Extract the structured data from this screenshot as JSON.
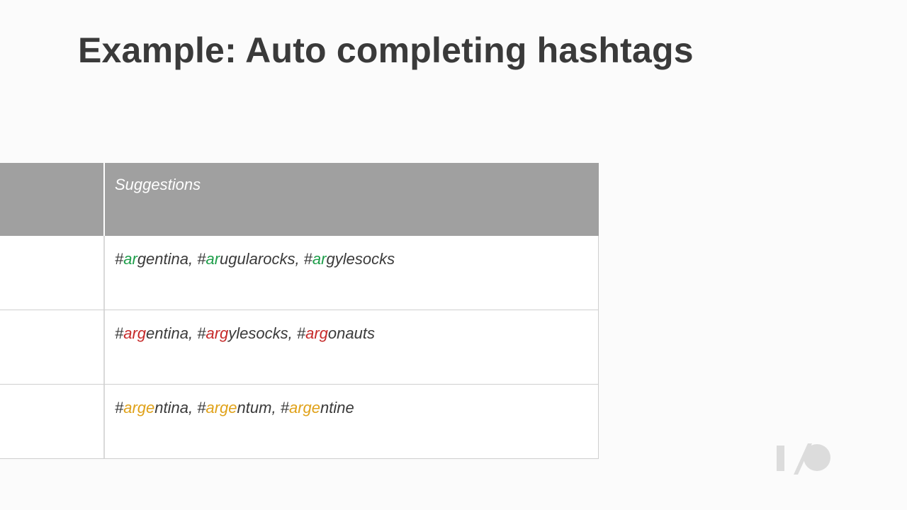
{
  "slide": {
    "title": "Example: Auto completing hashtags"
  },
  "table": {
    "header": {
      "left": "",
      "right": "Suggestions"
    },
    "rows": [
      {
        "color": "#1e9e4a",
        "tags": [
          {
            "hash": "#",
            "prefix": "ar",
            "rest": "gentina"
          },
          {
            "hash": "#",
            "prefix": "ar",
            "rest": "ugularocks"
          },
          {
            "hash": "#",
            "prefix": "ar",
            "rest": "gylesocks"
          }
        ]
      },
      {
        "color": "#c62a2a",
        "tags": [
          {
            "hash": "#",
            "prefix": "arg",
            "rest": "entina"
          },
          {
            "hash": "#",
            "prefix": "arg",
            "rest": "ylesocks"
          },
          {
            "hash": "#",
            "prefix": "arg",
            "rest": "onauts"
          }
        ]
      },
      {
        "color": "#e0a21a",
        "tags": [
          {
            "hash": "#",
            "prefix": "arge",
            "rest": "ntina"
          },
          {
            "hash": "#",
            "prefix": "arge",
            "rest": "ntum"
          },
          {
            "hash": "#",
            "prefix": "arge",
            "rest": "ntine"
          }
        ]
      }
    ],
    "separator": ", "
  },
  "logo": {
    "icon": "google-io-logo-icon",
    "color": "#dcdcdc"
  }
}
